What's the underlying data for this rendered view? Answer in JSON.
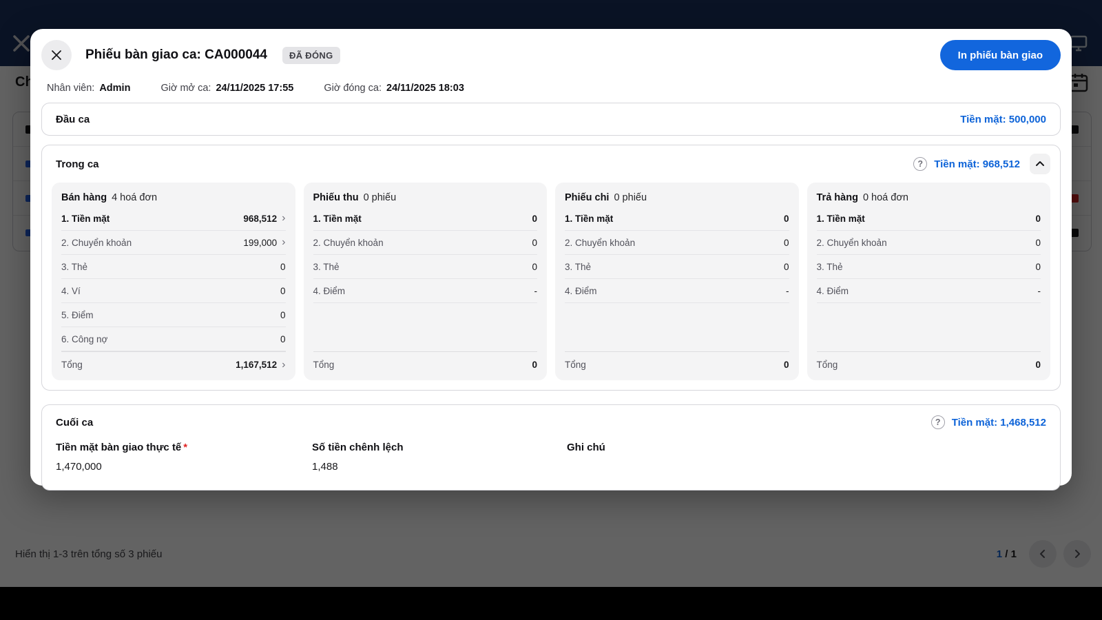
{
  "modal": {
    "title": "Phiếu bàn giao ca: CA000044",
    "status_badge": "ĐÃ ĐÓNG",
    "print_button": "In phiếu bàn giao",
    "info": {
      "staff_label": "Nhân viên:",
      "staff_value": "Admin",
      "open_label": "Giờ mở ca:",
      "open_value": "24/11/2025 17:55",
      "close_label": "Giờ đóng ca:",
      "close_value": "24/11/2025 18:03"
    },
    "dau_ca": {
      "title": "Đầu ca",
      "cash": "Tiền mặt: 500,000"
    },
    "trong_ca": {
      "title": "Trong ca",
      "cash": "Tiền mặt: 968,512",
      "columns": [
        {
          "title": "Bán hàng",
          "subtitle": "4 hoá đơn",
          "rows": [
            {
              "label": "1. Tiền mặt",
              "value": "968,512"
            },
            {
              "label": "2. Chuyển khoản",
              "value": "199,000"
            },
            {
              "label": "3. Thẻ",
              "value": "0"
            },
            {
              "label": "4. Ví",
              "value": "0"
            },
            {
              "label": "5. Điểm",
              "value": "0"
            },
            {
              "label": "6. Công nợ",
              "value": "0"
            }
          ],
          "total_label": "Tổng",
          "total_value": "1,167,512"
        },
        {
          "title": "Phiếu thu",
          "subtitle": "0 phiếu",
          "rows": [
            {
              "label": "1. Tiền mặt",
              "value": "0"
            },
            {
              "label": "2. Chuyển khoản",
              "value": "0"
            },
            {
              "label": "3. Thẻ",
              "value": "0"
            },
            {
              "label": "4. Điểm",
              "value": "-"
            }
          ],
          "total_label": "Tổng",
          "total_value": "0"
        },
        {
          "title": "Phiếu chi",
          "subtitle": "0 phiếu",
          "rows": [
            {
              "label": "1. Tiền mặt",
              "value": "0"
            },
            {
              "label": "2. Chuyển khoản",
              "value": "0"
            },
            {
              "label": "3. Thẻ",
              "value": "0"
            },
            {
              "label": "4. Điểm",
              "value": "-"
            }
          ],
          "total_label": "Tổng",
          "total_value": "0"
        },
        {
          "title": "Trả hàng",
          "subtitle": "0 hoá đơn",
          "rows": [
            {
              "label": "1. Tiền mặt",
              "value": "0"
            },
            {
              "label": "2. Chuyển khoản",
              "value": "0"
            },
            {
              "label": "3. Thẻ",
              "value": "0"
            },
            {
              "label": "4. Điểm",
              "value": "-"
            }
          ],
          "total_label": "Tổng",
          "total_value": "0"
        }
      ]
    },
    "cuoi_ca": {
      "title": "Cuối ca",
      "cash": "Tiền mặt: 1,468,512",
      "fields": [
        {
          "label": "Tiền mặt bàn giao thực tế",
          "required_mark": "*",
          "value": "1,470,000"
        },
        {
          "label": "Số tiền chênh lệch",
          "value": "1,488"
        },
        {
          "label": "Ghi chú",
          "value": ""
        }
      ]
    }
  },
  "background": {
    "heading_partial": "Ch",
    "footer": {
      "summary": "Hiển thị 1-3 trên tổng số 3 phiếu",
      "page_current": "1",
      "page_separator": " / ",
      "page_total": "1"
    }
  },
  "icons": {
    "question": "?",
    "chevron_right": "›",
    "close": "✕"
  },
  "colors": {
    "accent": "#0d63d8",
    "button_blue": "#1266dd",
    "navy_header": "#1a335f",
    "status_red": "#dc2626"
  }
}
